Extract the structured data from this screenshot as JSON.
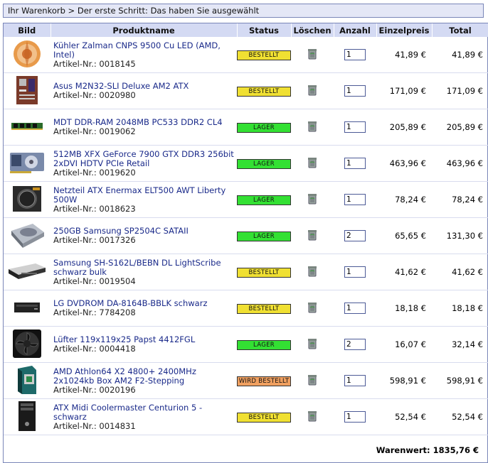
{
  "breadcrumb": "Ihr Warenkorb > Der erste Schritt: Das haben Sie ausgewählt",
  "columns": {
    "bild": "Bild",
    "produkt": "Produktname",
    "status": "Status",
    "loeschen": "Löschen",
    "anzahl": "Anzahl",
    "einzelpreis": "Einzelpreis",
    "total": "Total"
  },
  "status_colors": {
    "BESTELLT": "#f0e032",
    "LAGER": "#33e033",
    "WIRD BESTELLT": "#f0a060"
  },
  "items": [
    {
      "name": "Kühler Zalman CNPS 9500 Cu LED (AMD, Intel)",
      "art": "Artikel-Nr.: 0018145",
      "status": "BESTELLT",
      "qty": "1",
      "price": "41,89 €",
      "total": "41,89 €",
      "icon": "cpu-cooler-icon"
    },
    {
      "name": "Asus M2N32-SLI Deluxe AM2 ATX",
      "art": "Artikel-Nr.: 0020980",
      "status": "BESTELLT",
      "qty": "1",
      "price": "171,09 €",
      "total": "171,09 €",
      "icon": "motherboard-icon"
    },
    {
      "name": "MDT DDR-RAM 2048MB PC533 DDR2 CL4",
      "art": "Artikel-Nr.: 0019062",
      "status": "LAGER",
      "qty": "1",
      "price": "205,89 €",
      "total": "205,89 €",
      "icon": "ram-module-icon"
    },
    {
      "name": "512MB XFX GeForce 7900 GTX DDR3 256bit 2xDVI HDTV PCIe Retail",
      "art": "Artikel-Nr.: 0019620",
      "status": "LAGER",
      "qty": "1",
      "price": "463,96 €",
      "total": "463,96 €",
      "icon": "graphics-card-icon"
    },
    {
      "name": "Netzteil ATX Enermax ELT500 AWT Liberty 500W",
      "art": "Artikel-Nr.: 0018623",
      "status": "LAGER",
      "qty": "1",
      "price": "78,24 €",
      "total": "78,24 €",
      "icon": "power-supply-icon"
    },
    {
      "name": "250GB Samsung SP2504C SATAII",
      "art": "Artikel-Nr.: 0017326",
      "status": "LAGER",
      "qty": "2",
      "price": "65,65 €",
      "total": "131,30 €",
      "icon": "hard-drive-icon"
    },
    {
      "name": "Samsung SH-S162L/BEBN DL LightScribe schwarz bulk",
      "art": "Artikel-Nr.: 0019504",
      "status": "BESTELLT",
      "qty": "1",
      "price": "41,62 €",
      "total": "41,62 €",
      "icon": "dvd-burner-icon"
    },
    {
      "name": "LG DVDROM DA-8164B-BBLK schwarz",
      "art": "Artikel-Nr.: 7784208",
      "status": "BESTELLT",
      "qty": "1",
      "price": "18,18 €",
      "total": "18,18 €",
      "icon": "dvd-drive-icon"
    },
    {
      "name": "Lüfter 119x119x25 Papst 4412FGL",
      "art": "Artikel-Nr.: 0004418",
      "status": "LAGER",
      "qty": "2",
      "price": "16,07 €",
      "total": "32,14 €",
      "icon": "case-fan-icon"
    },
    {
      "name": "AMD Athlon64 X2 4800+ 2400MHz 2x1024kb Box AM2 F2-Stepping",
      "art": "Artikel-Nr.: 0020196",
      "status": "WIRD BESTELLT",
      "qty": "1",
      "price": "598,91 €",
      "total": "598,91 €",
      "icon": "cpu-box-icon"
    },
    {
      "name": "ATX Midi Coolermaster Centurion 5 - schwarz",
      "art": "Artikel-Nr.: 0014831",
      "status": "BESTELLT",
      "qty": "1",
      "price": "52,54 €",
      "total": "52,54 €",
      "icon": "pc-case-icon"
    }
  ],
  "summary": {
    "label": "Warenwert:",
    "value": "1835,76 €"
  }
}
